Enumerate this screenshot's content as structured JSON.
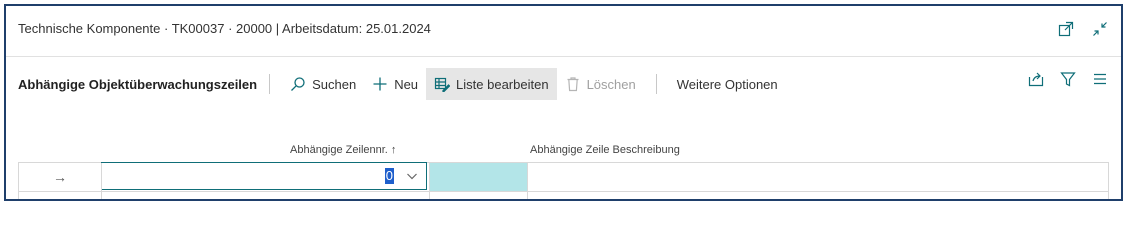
{
  "window": {
    "title": "Technische Komponente · TK00037 · 20000 | Arbeitsdatum: 25.01.2024",
    "icons": [
      "open-new-window-icon",
      "collapse-icon"
    ]
  },
  "action_bar": {
    "page_caption": "Abhängige Objektüberwachungszeilen",
    "search_label": "Suchen",
    "new_label": "Neu",
    "edit_list_label": "Liste bearbeiten",
    "delete_label": "Löschen",
    "more_options_label": "Weitere Optionen",
    "right_icons": [
      "share-icon",
      "filter-icon",
      "list-view-icon"
    ]
  },
  "grid": {
    "columns": [
      {
        "header": "Abhängige Zeilennr.",
        "sort": "↑"
      },
      {
        "header": "Abhängige Zeile Beschreibung"
      }
    ],
    "rows": [
      {
        "indicator": "→",
        "line_no": "0",
        "description": ""
      }
    ]
  },
  "colors": {
    "accent": "#0f6e78",
    "border": "#1f3f6b",
    "highlight_cell": "#b3e5e8",
    "selection": "#1f5fcc"
  }
}
